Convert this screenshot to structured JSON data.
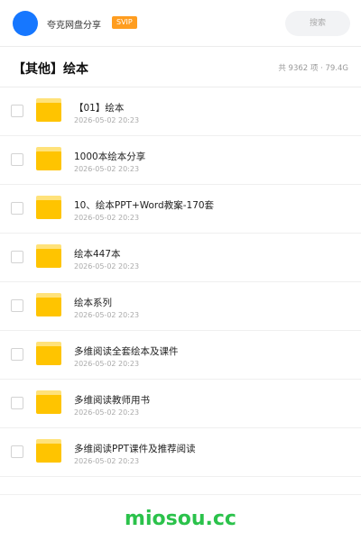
{
  "header": {
    "app_name": "夸克网盘分享",
    "badge": "SVIP",
    "search_placeholder": "搜索",
    "accent_color": "#1677ff"
  },
  "page": {
    "title": "【其他】绘本",
    "meta": "共 9362 项 · 79.4G"
  },
  "files": [
    {
      "name": "【01】绘本",
      "date": "2026-05-02 20:23",
      "icon": "folder-icon"
    },
    {
      "name": "1000本绘本分享",
      "date": "2026-05-02 20:23",
      "icon": "folder-icon"
    },
    {
      "name": "10、绘本PPT+Word教案-170套",
      "date": "2026-05-02 20:23",
      "icon": "folder-icon"
    },
    {
      "name": "绘本447本",
      "date": "2026-05-02 20:23",
      "icon": "folder-icon"
    },
    {
      "name": "绘本系列",
      "date": "2026-05-02 20:23",
      "icon": "folder-icon"
    },
    {
      "name": "多维阅读全套绘本及课件",
      "date": "2026-05-02 20:23",
      "icon": "folder-icon"
    },
    {
      "name": "多维阅读教师用书",
      "date": "2026-05-02 20:23",
      "icon": "folder-icon"
    },
    {
      "name": "多维阅读PPT课件及推荐阅读",
      "date": "2026-05-02 20:23",
      "icon": "folder-icon"
    }
  ],
  "footer": {
    "brand": "miosou.cc",
    "brand_color": "#2bc24b"
  }
}
